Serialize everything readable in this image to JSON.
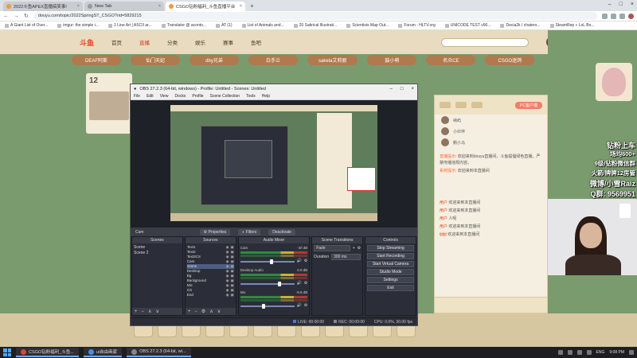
{
  "browser": {
    "tabs": [
      {
        "label": "2022斗鱼APEX直播搞笑事!",
        "active": false
      },
      {
        "label": "New Tab",
        "active": false
      },
      {
        "label": "CSGO钻粉福利_斗鱼直播平台",
        "active": true
      }
    ],
    "url": "douyu.com/topic/2022SpringST_CSGO?rid=5829215",
    "bookmarks": [
      "A Giant List of Over...",
      "imgur: the simple i...",
      "1 Line Art | ASCII ar...",
      "Translator @ aconto...",
      "AT (1)",
      "List of Animals and...",
      "20 Satirical Illustrati...",
      "Scientists Map Out...",
      "Forum - HLTV.org",
      "UNICODE TEST v90...",
      "Decia2k / chatero...",
      "SteamRep » LoL Bo..."
    ]
  },
  "site": {
    "logo": "斗鱼",
    "nav": [
      "首页",
      "直播",
      "分类",
      "娱乐",
      "赛事",
      "鱼吧"
    ],
    "pills": [
      "DEAF阿斯",
      "仙门天妃",
      "dby兄弟",
      "白手兰",
      "sakela艾莉丽",
      "鼓小萌",
      "名众CE",
      "CSGO迷鸽"
    ],
    "left_num": "12",
    "pc_button": "PC客户端",
    "chat_ranks": [
      "纳屿",
      "小伙伴",
      "鹅小马"
    ],
    "chat_messages": [
      {
        "user": "直播提示",
        "text": "欢迎来到douyu直播间，斗鱼提倡绿色直播，严禁传播违规内容。"
      },
      {
        "user": "系统提示",
        "text": "欢迎来到本直播间"
      },
      {
        "user": "用户",
        "text": "欢迎来到本直播间"
      },
      {
        "user": "用户",
        "text": "欢迎来到本直播间"
      },
      {
        "user": "用户",
        "text": "人呢"
      },
      {
        "user": "用户",
        "text": "欢迎来到本直播间"
      },
      {
        "user": "tjtjtjt",
        "text": "欢迎来到本直播间"
      }
    ]
  },
  "overlay": {
    "lines": [
      "钻粉上车",
      "场均600+",
      "9级/钻粉微信群",
      "火箭/牌牌12房管",
      "微博/小雪Raiz",
      "Q群: 9569951"
    ]
  },
  "obs": {
    "title": "OBS 27.2.3 (64-bit, windows) - Profile: Untitled - Scenes: Untitled",
    "menu": [
      "File",
      "Edit",
      "View",
      "Docks",
      "Profile",
      "Scene Collection",
      "Tools",
      "Help"
    ],
    "source_name": "Cam",
    "properties_label": "Properties",
    "filters_label": "Filters",
    "deactivate_label": "Deactivate",
    "docks": {
      "scenes": {
        "title": "Scenes",
        "items": [
          "Scene",
          "Scene 2"
        ]
      },
      "sources": {
        "title": "Sources",
        "items": [
          "Text1",
          "Text2",
          "Text3CS",
          "Cam",
          "Game",
          "Desktop",
          "Bg",
          "Background",
          "Mic",
          "CS",
          "End",
          "Intro"
        ]
      },
      "mixer": {
        "title": "Audio Mixer",
        "channels": [
          {
            "name": "Cam",
            "db": "-inf dB",
            "level": 0.55
          },
          {
            "name": "Desktop Audio",
            "db": "0.0 dB",
            "level": 0.7
          },
          {
            "name": "Mic",
            "db": "-9.8 dB",
            "level": 0.4
          }
        ]
      },
      "transitions": {
        "title": "Scene Transitions",
        "type": "Fade",
        "duration_label": "Duration",
        "duration": "300 ms"
      },
      "controls": {
        "title": "Controls",
        "buttons": [
          "Stop Streaming",
          "Start Recording",
          "Start Virtual Camera",
          "Studio Mode",
          "Settings",
          "Exit"
        ]
      }
    },
    "status": {
      "live": "LIVE: 00:00:00",
      "rec": "REC: 00:00:00",
      "cpu": "CPU: 0.0%, 30.00 fps"
    }
  },
  "taskbar": {
    "apps": [
      "CSGO钻粉福利_斗鱼...",
      "ui自由画家",
      "OBS 27.2.3 (64-bit, wi..."
    ],
    "lang": "ENG",
    "time": "9:08 PM"
  }
}
